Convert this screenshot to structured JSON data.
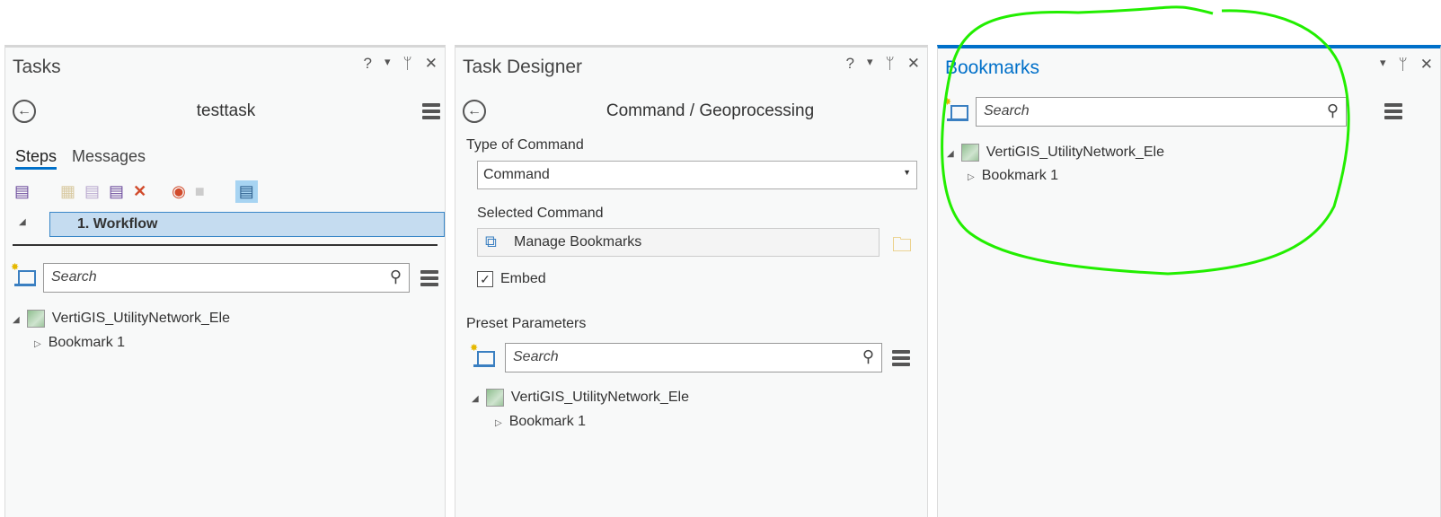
{
  "tasks": {
    "title": "Tasks",
    "controls": [
      "?",
      "▾",
      "📌",
      "✕"
    ],
    "task_name": "testtask",
    "tabs": [
      "Steps",
      "Messages"
    ],
    "step": "1.  Workflow",
    "search_placeholder": "Search",
    "tree": {
      "map": "VertiGIS_UtilityNetwork_Ele",
      "bookmark": "Bookmark 1"
    }
  },
  "designer": {
    "title": "Task Designer",
    "controls": [
      "?",
      "▾",
      "📌",
      "✕"
    ],
    "heading": "Command / Geoprocessing",
    "type_label": "Type of Command",
    "type_value": "Command",
    "selected_label": "Selected Command",
    "selected_value": "Manage Bookmarks",
    "embed_label": "Embed",
    "preset_label": "Preset Parameters",
    "search_placeholder": "Search",
    "tree": {
      "map": "VertiGIS_UtilityNetwork_Ele",
      "bookmark": "Bookmark 1"
    }
  },
  "bookmarks": {
    "title": "Bookmarks",
    "controls": [
      "▾",
      "📌",
      "✕"
    ],
    "search_placeholder": "Search",
    "tree": {
      "map": "VertiGIS_UtilityNetwork_Ele",
      "bookmark": "Bookmark 1"
    },
    "accent": "#0070c9",
    "annotation_color": "#22ee00"
  }
}
